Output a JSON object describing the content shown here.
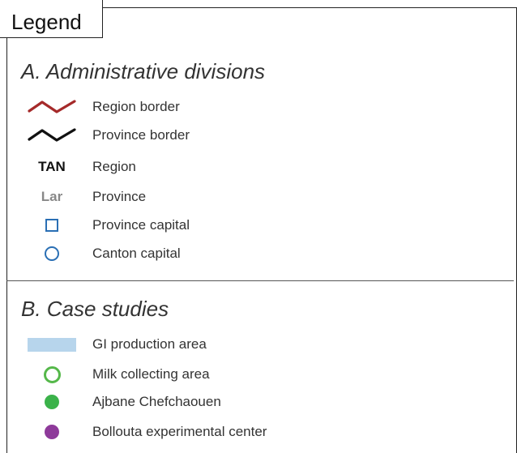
{
  "legend": {
    "title": "Legend",
    "sections": [
      {
        "title": "A. Administrative divisions",
        "items": [
          {
            "label": "Region border",
            "symbol": "line",
            "color": "#a52a2a"
          },
          {
            "label": "Province border",
            "symbol": "line",
            "color": "#111111"
          },
          {
            "label": "Region",
            "symbol": "text",
            "text": "TAN",
            "color": "#111111"
          },
          {
            "label": "Province",
            "symbol": "text",
            "text": "Lar",
            "color": "#888888"
          },
          {
            "label": "Province capital",
            "symbol": "square-outline",
            "color": "#2a6fb4"
          },
          {
            "label": "Canton capital",
            "symbol": "circle-outline",
            "color": "#2a6fb4"
          }
        ]
      },
      {
        "title": "B. Case studies",
        "items": [
          {
            "label": "GI production area",
            "symbol": "rectangle-fill",
            "color": "#b7d5ec"
          },
          {
            "label": "Milk collecting area",
            "symbol": "circle-outline",
            "color": "#55b84a"
          },
          {
            "label": "Ajbane Chefchaouen",
            "symbol": "dot",
            "color": "#3bb24a"
          },
          {
            "label": "Bollouta experimental center",
            "symbol": "dot",
            "color": "#8e3a9a"
          }
        ]
      }
    ]
  }
}
